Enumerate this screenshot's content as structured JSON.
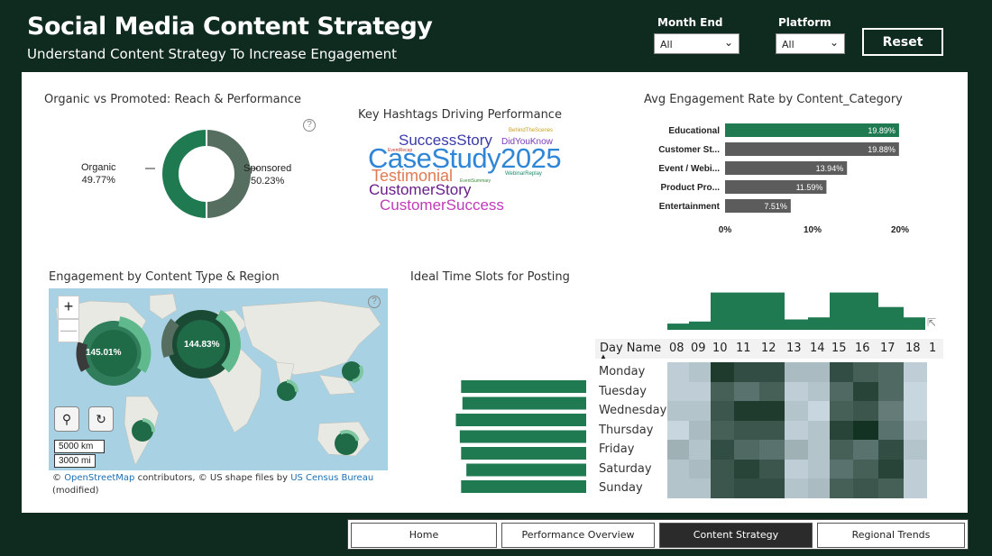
{
  "header": {
    "title": "Social Media Content Strategy",
    "subtitle": "Understand Content Strategy To Increase Engagement",
    "filters": [
      {
        "label": "Month End",
        "value": "All"
      },
      {
        "label": "Platform",
        "value": "All"
      }
    ],
    "reset_label": "Reset"
  },
  "donut": {
    "title": "Organic vs Promoted: Reach & Performance",
    "slices": [
      {
        "label": "Organic",
        "pct": "49.77%",
        "value": 49.77,
        "color": "#1f7a52"
      },
      {
        "label": "Sponsored",
        "pct": "50.23%",
        "value": 50.23,
        "color": "#566e60"
      }
    ]
  },
  "hashtags": {
    "title": "Key Hashtags Driving Performance",
    "words": [
      {
        "text": "SuccessStory",
        "color": "#3a3aa8"
      },
      {
        "text": "BehindTheScenes",
        "color": "#c9a01e"
      },
      {
        "text": "DidYouKnow",
        "color": "#7a3ab8"
      },
      {
        "text": "EventRecap",
        "color": "#c0392b"
      },
      {
        "text": "CaseStudy2025",
        "color": "#2f86d6"
      },
      {
        "text": "Testimonial",
        "color": "#e07a52"
      },
      {
        "text": "WebinarReplay",
        "color": "#1f8a6a"
      },
      {
        "text": "EventSummary",
        "color": "#3a8a3a"
      },
      {
        "text": "CustomerStory",
        "color": "#6a1e8a"
      },
      {
        "text": "CustomerSuccess",
        "color": "#c03ab8"
      }
    ]
  },
  "engagement_bar": {
    "title": "Avg Engagement Rate by Content_Category",
    "ticks": [
      "0%",
      "10%",
      "20%"
    ]
  },
  "map": {
    "title": "Engagement by Content Type & Region",
    "bubbles": [
      {
        "label": "145.01%"
      },
      {
        "label": "144.83%"
      }
    ],
    "scale_km": "5000 km",
    "scale_mi": "3000 mi",
    "credit_prefix": "©",
    "credit_osm": "OpenStreetMap",
    "credit_mid": "contributors, © US shape files by",
    "credit_census": "US Census Bureau",
    "credit_suffix": "(modified)",
    "zoom_in": "+",
    "zoom_out": "—"
  },
  "heatmap": {
    "title": "Ideal Time Slots for Posting",
    "row_header": "Day Name",
    "hours": [
      "08",
      "09",
      "10",
      "11",
      "12",
      "13",
      "14",
      "15",
      "16",
      "17",
      "18",
      "1"
    ],
    "days": [
      "Monday",
      "Tuesday",
      "Wednesday",
      "Thursday",
      "Friday",
      "Saturday",
      "Sunday"
    ]
  },
  "nav": {
    "tabs": [
      {
        "label": "Home",
        "active": false
      },
      {
        "label": "Performance Overview",
        "active": false
      },
      {
        "label": "Content Strategy",
        "active": true
      },
      {
        "label": "Regional Trends",
        "active": false
      }
    ]
  },
  "chart_data": [
    {
      "type": "pie",
      "title": "Organic vs Promoted: Reach & Performance",
      "categories": [
        "Organic",
        "Sponsored"
      ],
      "values": [
        49.77,
        50.23
      ]
    },
    {
      "type": "bar",
      "title": "Avg Engagement Rate by Content_Category",
      "categories": [
        "Educational",
        "Customer St...",
        "Event / Webi...",
        "Product Pro...",
        "Entertainment"
      ],
      "values": [
        19.89,
        19.88,
        13.94,
        11.59,
        7.51
      ],
      "labels": [
        "19.89%",
        "19.88%",
        "13.94%",
        "11.59%",
        "7.51%"
      ],
      "colors": [
        "#1f7a52",
        "#5c5c5c",
        "#5c5c5c",
        "#5c5c5c",
        "#5c5c5c"
      ],
      "xlim": [
        0,
        20
      ],
      "ticks": [
        0,
        10,
        20
      ]
    },
    {
      "type": "heatmap",
      "title": "Ideal Time Slots for Posting",
      "x": [
        "08",
        "09",
        "10",
        "11",
        "12",
        "13",
        "14",
        "15",
        "16",
        "17",
        "18"
      ],
      "y": [
        "Monday",
        "Tuesday",
        "Wednesday",
        "Thursday",
        "Friday",
        "Saturday",
        "Sunday"
      ],
      "z": [
        [
          0.15,
          0.2,
          0.95,
          0.85,
          0.85,
          0.25,
          0.25,
          0.85,
          0.75,
          0.7,
          0.15
        ],
        [
          0.15,
          0.15,
          0.75,
          0.65,
          0.75,
          0.15,
          0.2,
          0.7,
          0.9,
          0.7,
          0.1
        ],
        [
          0.2,
          0.2,
          0.8,
          0.95,
          0.95,
          0.2,
          0.1,
          0.75,
          0.8,
          0.6,
          0.1
        ],
        [
          0.1,
          0.25,
          0.75,
          0.8,
          0.8,
          0.15,
          0.2,
          0.9,
          1.0,
          0.65,
          0.15
        ],
        [
          0.3,
          0.2,
          0.85,
          0.7,
          0.65,
          0.3,
          0.2,
          0.75,
          0.65,
          0.85,
          0.2
        ],
        [
          0.2,
          0.25,
          0.8,
          0.9,
          0.8,
          0.15,
          0.2,
          0.65,
          0.75,
          0.9,
          0.15
        ],
        [
          0.2,
          0.2,
          0.8,
          0.85,
          0.85,
          0.2,
          0.25,
          0.75,
          0.8,
          0.75,
          0.15
        ]
      ],
      "column_totals": [
        0.15,
        0.2,
        0.9,
        0.9,
        0.9,
        0.25,
        0.3,
        0.9,
        0.9,
        0.55,
        0.3
      ],
      "row_totals": [
        0.95,
        0.94,
        0.99,
        0.96,
        0.95,
        0.91,
        0.95
      ]
    }
  ]
}
